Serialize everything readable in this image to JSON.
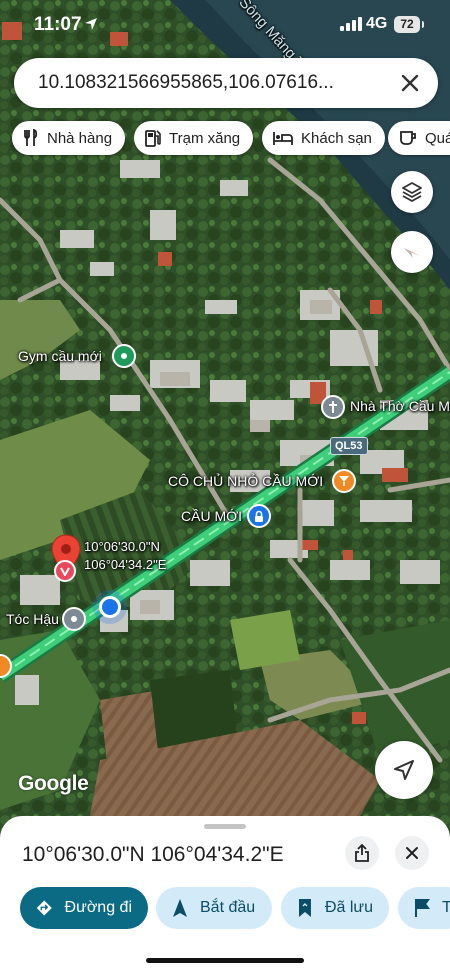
{
  "status_bar": {
    "time": "11:07",
    "network": "4G",
    "battery": "72"
  },
  "search": {
    "query": "10.108321566955865,106.07616..."
  },
  "chips": [
    {
      "label": "Nhà hàng",
      "icon": "restaurant-icon"
    },
    {
      "label": "Trạm xăng",
      "icon": "gas-station-icon"
    },
    {
      "label": "Khách sạn",
      "icon": "hotel-icon"
    },
    {
      "label": "Quá",
      "icon": "coffee-icon"
    }
  ],
  "map": {
    "river_label": "Sông Măng Thít",
    "places": {
      "gym": "Gym cầu mới",
      "church": "Nhà Thờ Cầu M",
      "cafe": "CÔ CHỦ NHỎ CẦU MỚI",
      "bridge": "CẦU MỚI",
      "toc_hau": "Tóc Hậu"
    },
    "road_badge": "QL53",
    "pin_label_line1": "10°06'30.0\"N",
    "pin_label_line2": "106°04'34.2\"E",
    "attribution": "Google"
  },
  "sheet": {
    "coordinates": "10°06'30.0\"N 106°04'34.2\"E",
    "actions": [
      {
        "label": "Đường đi",
        "icon": "directions-icon"
      },
      {
        "label": "Bắt đầu",
        "icon": "navigation-arrow-icon"
      },
      {
        "label": "Đã lưu",
        "icon": "bookmark-icon"
      },
      {
        "label": "T",
        "icon": "flag-icon"
      }
    ]
  },
  "colors": {
    "primary": "#0b6b85",
    "secondary_button": "#d3ebf8",
    "pin_red": "#ea4335",
    "location_blue": "#1a73e8",
    "road_green": "#3fce7a"
  }
}
